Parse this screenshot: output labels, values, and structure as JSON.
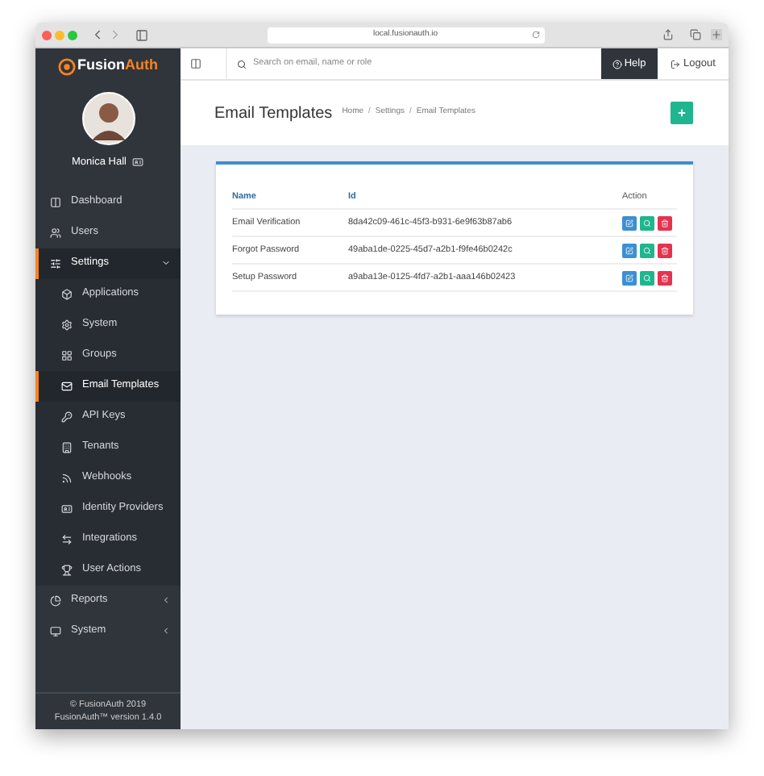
{
  "browser": {
    "url": "local.fusionauth.io"
  },
  "header": {
    "logo_first": "Fusion",
    "logo_second": "Auth",
    "search": {
      "placeholder": "Search on email, name or role"
    },
    "help": "Help",
    "logout": "Logout"
  },
  "user": {
    "name": "Monica Hall"
  },
  "nav": [
    {
      "label": "Dashboard",
      "selected": false
    },
    {
      "label": "Users",
      "selected": false
    },
    {
      "label": "Settings",
      "selected": true,
      "expanded": true,
      "children": [
        {
          "label": "Applications",
          "selected": false
        },
        {
          "label": "System",
          "selected": false
        },
        {
          "label": "Groups",
          "selected": false
        },
        {
          "label": "Email Templates",
          "selected": true
        },
        {
          "label": "API Keys",
          "selected": false
        },
        {
          "label": "Tenants",
          "selected": false
        },
        {
          "label": "Webhooks",
          "selected": false
        },
        {
          "label": "Identity Providers",
          "selected": false
        },
        {
          "label": "Integrations",
          "selected": false
        },
        {
          "label": "User Actions",
          "selected": false
        }
      ]
    },
    {
      "label": "Reports",
      "selected": false,
      "expanded": false
    },
    {
      "label": "System",
      "selected": false,
      "expanded": false
    }
  ],
  "footer": [
    "© FusionAuth 2019",
    "FusionAuth™ version 1.4.0"
  ],
  "page": {
    "title": "Email Templates",
    "breadcrumbs": [
      "Home",
      "Settings",
      "Email Templates"
    ],
    "breadcrumb_separator": "/"
  },
  "table": {
    "columns": [
      "Name",
      "Id",
      "Action"
    ],
    "rows": [
      {
        "name": "Email Verification",
        "id": "8da42c09-461c-45f3-b931-6e9f63b87ab6"
      },
      {
        "name": "Forgot Password",
        "id": "49aba1de-0225-45d7-a2b1-f9fe46b0242c"
      },
      {
        "name": "Setup Password",
        "id": "a9aba13e-0125-4fd7-a2b1-aaa146b02423"
      }
    ]
  }
}
